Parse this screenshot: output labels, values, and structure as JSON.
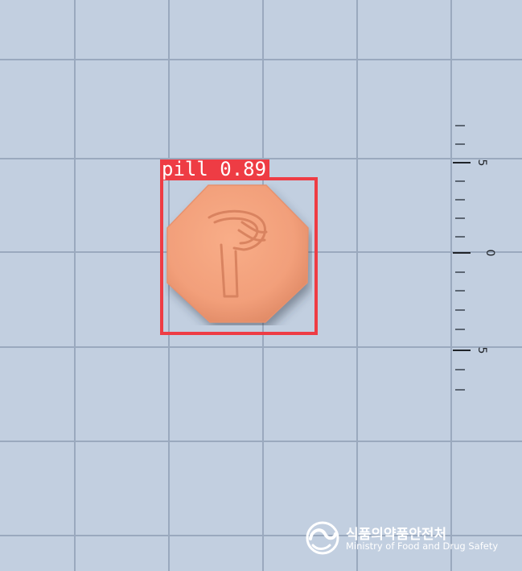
{
  "detection": {
    "label": "pill 0.89",
    "box_color": "#ee3c44"
  },
  "pill": {
    "color": "#f5a07a",
    "imprint_icon": "stylized-p-imprint"
  },
  "ruler": {
    "labels": [
      "5",
      "0",
      "5"
    ]
  },
  "watermark": {
    "organization_ko": "식품의약품안전처",
    "organization_en": "Ministry of Food and Drug Safety",
    "logo_icon": "taegeuk-swirl-icon"
  }
}
